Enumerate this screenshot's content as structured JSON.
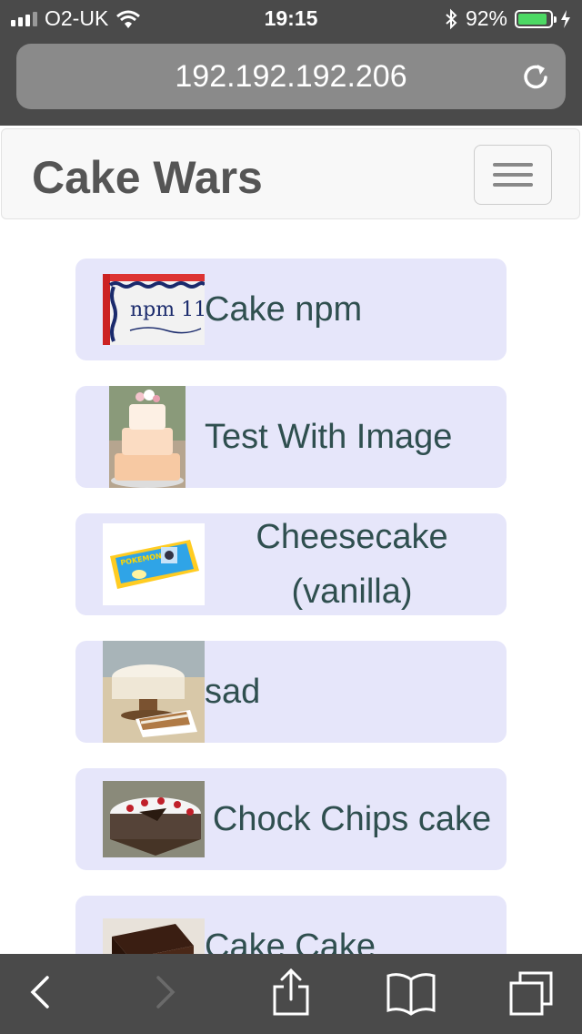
{
  "status": {
    "carrier": "O2-UK",
    "time": "19:15",
    "battery": "92%",
    "battery_level": 0.92
  },
  "browser": {
    "url": "192.192.192.206"
  },
  "navbar": {
    "brand": "Cake Wars"
  },
  "cakes": [
    {
      "title": "Cake npm",
      "image": "npm-cake-photo"
    },
    {
      "title": "Test With Image",
      "image": "tiered-wedding-cake-photo"
    },
    {
      "title": "Cheesecake (vanilla)",
      "image": "pokemon-sheet-cake-photo"
    },
    {
      "title": "sad",
      "image": "carrot-cake-photo"
    },
    {
      "title": "Chock Chips cake",
      "image": "black-forest-cake-photo"
    },
    {
      "title": "Cake Cake",
      "image": "chocolate-cake-slice-photo"
    }
  ],
  "colors": {
    "card_bg": "#e6e6fa",
    "card_text": "#2f4f4f",
    "chrome": "#4a4a4a",
    "battery": "#4cd964"
  },
  "icons": {
    "back": "chevron-left-icon",
    "forward": "chevron-right-icon",
    "share": "share-icon",
    "bookmarks": "book-icon",
    "tabs": "tabs-icon",
    "reload": "reload-icon",
    "menu": "hamburger-icon"
  }
}
